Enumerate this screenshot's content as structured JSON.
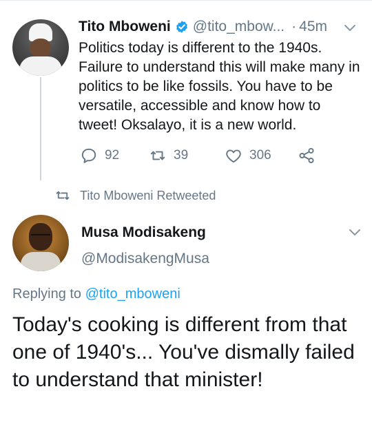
{
  "tweet1": {
    "display_name": "Tito Mboweni",
    "handle": "@tito_mbow...",
    "separator": "·",
    "time": "45m",
    "text": "Politics today is different to the 1940s. Failure to understand this will make many in politics to be like fossils. You have to be versatile, accessible and know how to tweet! Oksalayo, it is a new world.",
    "replies": "92",
    "retweets": "39",
    "likes": "306"
  },
  "retweet_label": "Tito Mboweni Retweeted",
  "tweet2": {
    "display_name": "Musa Modisakeng",
    "handle": "@ModisakengMusa",
    "replying_prefix": "Replying to",
    "replying_to": "@tito_mboweni",
    "text": "Today's cooking is different from that one of 1940's... You've dismally failed to understand that minister!"
  },
  "colors": {
    "text": "#14171a",
    "muted": "#657786",
    "link": "#1da1f2",
    "verified": "#1da1f2"
  }
}
